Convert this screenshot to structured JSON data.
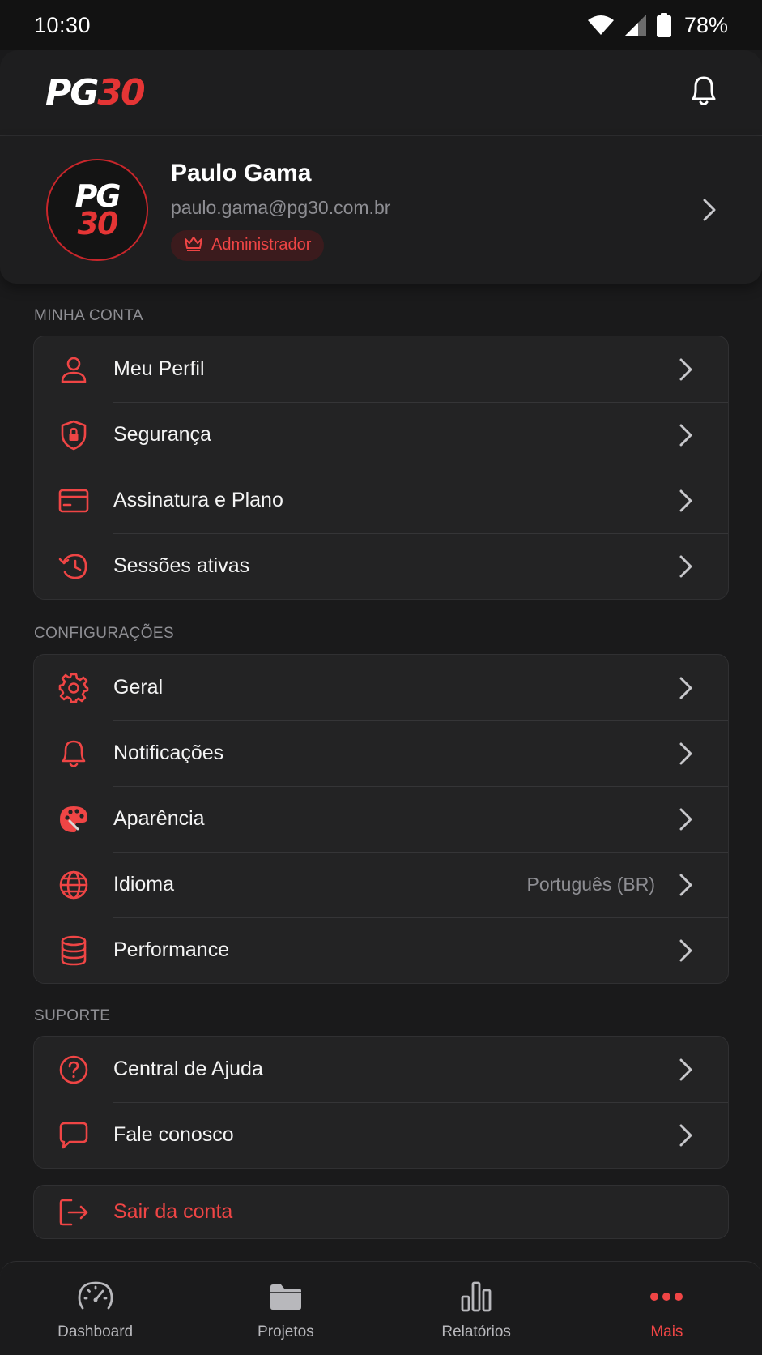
{
  "status_bar": {
    "time": "10:30",
    "battery": "78%"
  },
  "header": {
    "logo_left": "PG",
    "logo_right": "30"
  },
  "profile": {
    "avatar_top": "PG",
    "avatar_bottom": "30",
    "name": "Paulo Gama",
    "email": "paulo.gama@pg30.com.br",
    "role": "Administrador"
  },
  "sections": {
    "account": {
      "title": "MINHA CONTA",
      "items": [
        {
          "label": "Meu Perfil",
          "icon": "user-icon"
        },
        {
          "label": "Segurança",
          "icon": "shield-lock-icon"
        },
        {
          "label": "Assinatura e Plano",
          "icon": "credit-card-icon"
        },
        {
          "label": "Sessões ativas",
          "icon": "history-icon"
        }
      ]
    },
    "settings": {
      "title": "CONFIGURAÇÕES",
      "items": [
        {
          "label": "Geral",
          "icon": "gear-icon"
        },
        {
          "label": "Notificações",
          "icon": "bell-icon"
        },
        {
          "label": "Aparência",
          "icon": "palette-icon"
        },
        {
          "label": "Idioma",
          "icon": "globe-icon",
          "value": "Português (BR)"
        },
        {
          "label": "Performance",
          "icon": "database-icon"
        }
      ]
    },
    "support": {
      "title": "SUPORTE",
      "items": [
        {
          "label": "Central de Ajuda",
          "icon": "help-circle-icon"
        },
        {
          "label": "Fale conosco",
          "icon": "chat-icon"
        }
      ]
    }
  },
  "logout": {
    "label": "Sair da conta",
    "icon": "logout-icon"
  },
  "bottom_nav": {
    "items": [
      {
        "label": "Dashboard",
        "icon": "speedometer-icon"
      },
      {
        "label": "Projetos",
        "icon": "folder-icon"
      },
      {
        "label": "Relatórios",
        "icon": "bar-chart-icon"
      },
      {
        "label": "Mais",
        "icon": "more-dots-icon",
        "active": true
      }
    ]
  },
  "colors": {
    "accent": "#ef4545",
    "background": "#1a1a1b",
    "card": "#232324",
    "muted": "#8e8e93"
  }
}
